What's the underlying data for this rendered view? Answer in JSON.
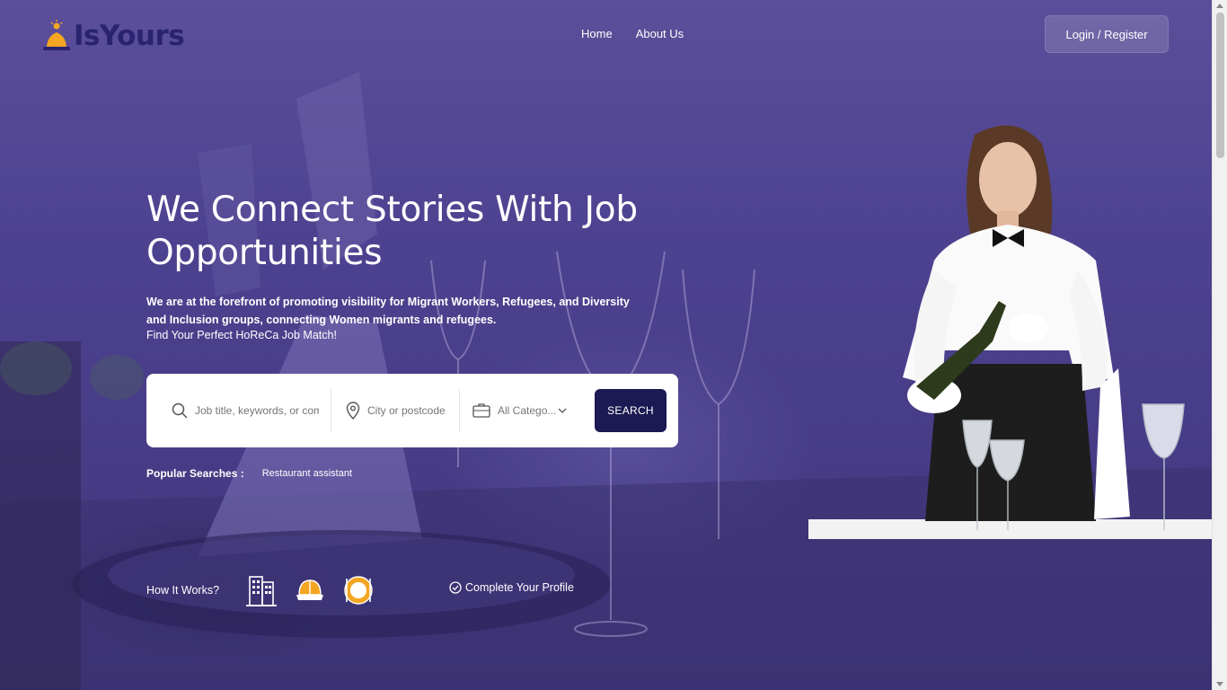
{
  "brand": {
    "name": "IsYours",
    "accent": "#2a2370",
    "sun_color": "#f4a623"
  },
  "nav": {
    "home": "Home",
    "about": "About Us"
  },
  "header": {
    "login_label": "Login / Register"
  },
  "hero": {
    "headline": "We Connect Stories With Job Opportunities",
    "subhead": "We are at the forefront of promoting visibility for Migrant Workers, Refugees, and Diversity and Inclusion groups, connecting Women migrants and refugees.",
    "tagline": "Find Your Perfect HoReCa Job Match!"
  },
  "search": {
    "keyword_placeholder": "Job title, keywords, or company",
    "city_placeholder": "City or postcode",
    "category_value": "All Catego...",
    "button_label": "SEARCH"
  },
  "popular": {
    "label": "Popular Searches :",
    "tags": [
      "Restaurant assistant"
    ]
  },
  "how_it_works": {
    "label": "How It Works?",
    "icons": [
      "building-icon",
      "hard-hat-icon",
      "plate-icon"
    ],
    "complete_label": "Complete Your Profile"
  },
  "colors": {
    "button_dark": "#1c1a52",
    "overlay": "#4d4290"
  }
}
